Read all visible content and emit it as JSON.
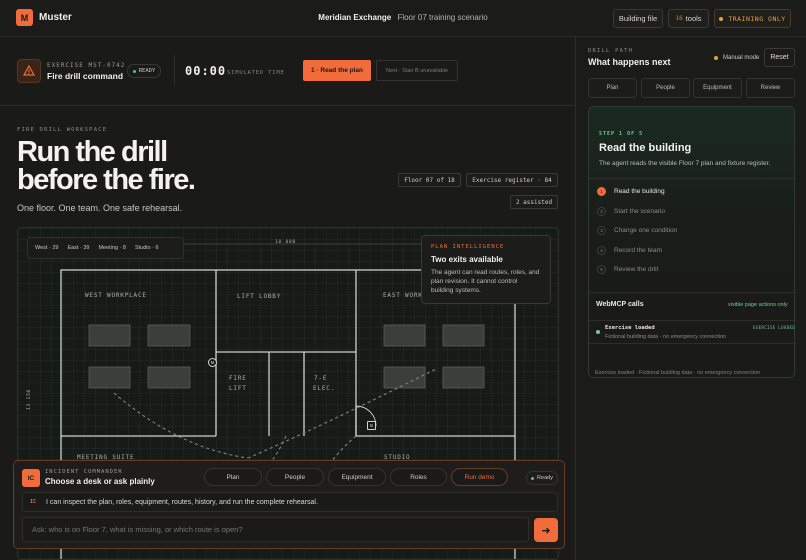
{
  "app": {
    "logo_letter": "M",
    "name": "Muster",
    "location": "Meridian Exchange",
    "scenario": "Floor 07 training scenario",
    "building_file_label": "Building file",
    "tools_count": "16",
    "tools_label": "tools",
    "training_label": "TRAINING ONLY"
  },
  "exercise": {
    "code": "EXERCISE MST-0742",
    "name": "Fire drill command",
    "status": "READY",
    "clock": "00:00",
    "clock_label": "SIMULATED TIME",
    "primary_action": "1 · Read the plan",
    "next_action": "Next · Stair B unavailable"
  },
  "workspace": {
    "label": "FIRE DRILL WORKSPACE",
    "headline_1": "Run the drill",
    "headline_2": "before the fire.",
    "subline": "One floor. One team. One safe rehearsal.",
    "floor_chip": "Floor 07 of 18",
    "register_chip": "Exercise register · 84",
    "assisted_chip": "2 assisted"
  },
  "plan": {
    "stats": [
      "West · 29",
      "East · 39",
      "Meeting · 8",
      "Studio · 6"
    ],
    "dim_top": "18 000",
    "dim_left": "13 150",
    "rooms": {
      "west": "WEST WORKPLACE",
      "lobby": "LIFT LOBBY",
      "east": "EAST WORKPLACE",
      "fire": "FIRE",
      "lift": "LIFT",
      "elec_1": "7-E",
      "elec_2": "ELEC.",
      "meeting": "MEETING SUITE",
      "studio": "STUDIO"
    },
    "markers": {
      "m": "M",
      "b": "B"
    },
    "intel": {
      "label": "PLAN INTELLIGENCE",
      "title": "Two exits available",
      "body": "The agent can read routes, roles, and plan revision. It cannot control building systems."
    }
  },
  "commander": {
    "badge": "IC",
    "label": "INCIDENT COMMANDER",
    "title": "Choose a desk or ask plainly",
    "tabs": [
      "Plan",
      "People",
      "Equipment",
      "Roles",
      "Run demo"
    ],
    "status": "Ready",
    "message_who": "IC",
    "message": "I can inspect the plan, roles, equipment, routes, history, and run the complete rehearsal.",
    "input_placeholder": "Ask: who is on Floor 7, what is missing, or which route is open?",
    "send_glyph": "➜"
  },
  "drill": {
    "label": "DRILL PATH",
    "title": "What happens next",
    "mode": "Manual mode",
    "reset": "Reset",
    "tabs": [
      "Plan",
      "People",
      "Equipment",
      "Review"
    ],
    "step_counter": "STEP 1 OF 5",
    "step_title": "Read the building",
    "step_desc": "The agent reads the visible Floor 7 plan and fixture register.",
    "steps": [
      {
        "num": "1",
        "label": "Read the building"
      },
      {
        "num": "2",
        "label": "Start the scenario"
      },
      {
        "num": "3",
        "label": "Change one condition"
      },
      {
        "num": "4",
        "label": "Record the team"
      },
      {
        "num": "5",
        "label": "Review the drill"
      }
    ],
    "mcp": {
      "title": "WebMCP calls",
      "visibility": "visible page actions only",
      "event": "Exercise loaded",
      "event_desc": "Fictional building data · no emergency connection",
      "event_tag": "EXERCISE LOADED",
      "footer": "Exercise loaded · Fictional building data · no emergency connection"
    }
  },
  "colors": {
    "accent": "#f26b3a",
    "background": "#1a1a18",
    "success": "#6fcf8f",
    "warning": "#e6a23c"
  }
}
